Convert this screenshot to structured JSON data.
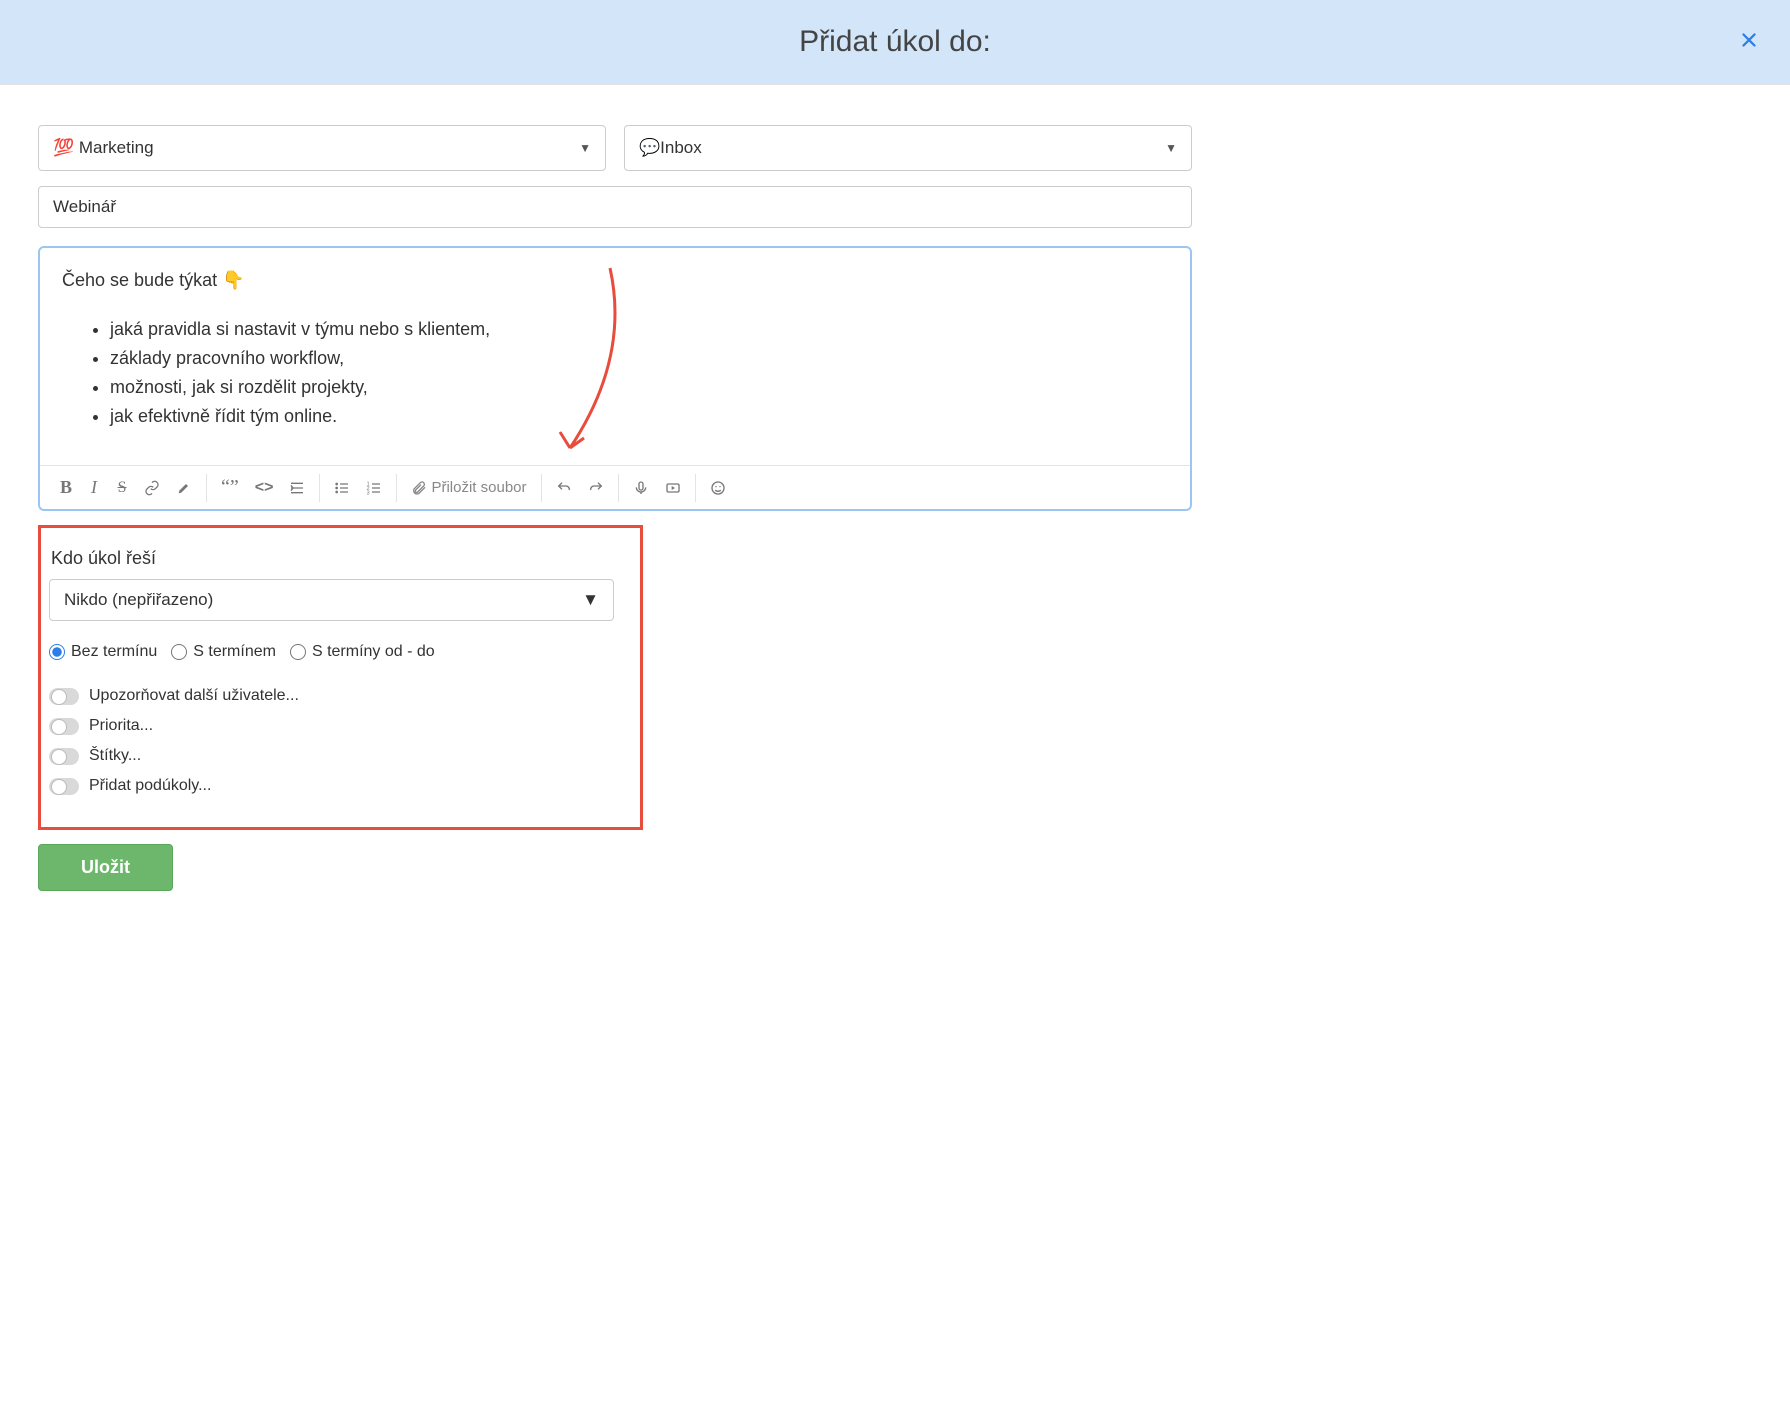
{
  "header": {
    "title": "Přidat úkol do:"
  },
  "project_select": {
    "value": "💯 Marketing"
  },
  "list_select": {
    "value": "💬Inbox"
  },
  "task_name": {
    "value": "Webinář"
  },
  "editor": {
    "intro": "Čeho se bude týkat 👇",
    "bullets": [
      "jaká pravidla si nastavit v týmu nebo s klientem,",
      "základy pracovního workflow,",
      "možnosti, jak si rozdělit projekty,",
      "jak efektivně řídit tým online."
    ],
    "attach_label": "Přiložit soubor"
  },
  "assignee": {
    "label": "Kdo úkol řeší",
    "value": "Nikdo (nepřiřazeno)"
  },
  "deadline_radios": {
    "none": "Bez termínu",
    "with": "S termínem",
    "range": "S termíny od - do"
  },
  "toggles": {
    "notify": "Upozorňovat další uživatele...",
    "priority": "Priorita...",
    "tags": "Štítky...",
    "subtasks": "Přidat podúkoly..."
  },
  "save": "Uložit"
}
